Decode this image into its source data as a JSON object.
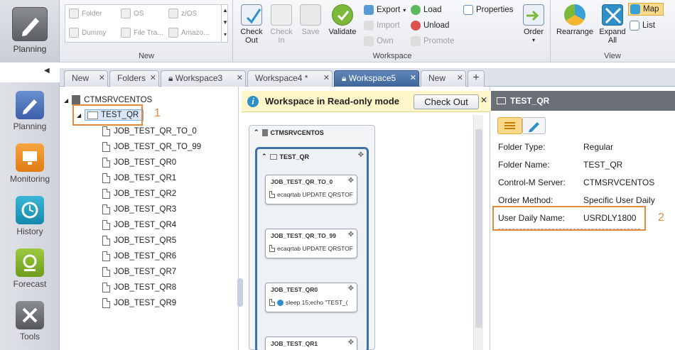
{
  "ribbon": {
    "planning_label": "Planning",
    "new_group": {
      "title": "New",
      "items": [
        "Folder",
        "OS",
        "z/OS",
        "Dummy",
        "File Tra...",
        "Amazo..."
      ]
    },
    "workspace_group": {
      "title": "Workspace",
      "check_out": "Check Out",
      "check_in": "Check In",
      "save": "Save",
      "validate": "Validate",
      "export": "Export",
      "import": "Import",
      "own": "Own",
      "load": "Load",
      "unload": "Unload",
      "promote": "Promote",
      "properties": "Properties",
      "order": "Order"
    },
    "view_group": {
      "title": "View",
      "rearrange": "Rearrange",
      "expand_all": "Expand All",
      "map": "Map",
      "list": "List"
    }
  },
  "tabs": [
    {
      "label": "New"
    },
    {
      "label": "Folders"
    },
    {
      "label": "Workspace3"
    },
    {
      "label": "Workspace4 *"
    },
    {
      "label": "Workspace5"
    },
    {
      "label": "New"
    }
  ],
  "nav": [
    {
      "label": "Planning"
    },
    {
      "label": "Monitoring"
    },
    {
      "label": "History"
    },
    {
      "label": "Forecast"
    },
    {
      "label": "Tools"
    }
  ],
  "tree": {
    "server": "CTMSRVCENTOS",
    "folder": "TEST_QR",
    "jobs": [
      "JOB_TEST_QR_TO_0",
      "JOB_TEST_QR_TO_99",
      "JOB_TEST_QR0",
      "JOB_TEST_QR1",
      "JOB_TEST_QR2",
      "JOB_TEST_QR3",
      "JOB_TEST_QR4",
      "JOB_TEST_QR5",
      "JOB_TEST_QR6",
      "JOB_TEST_QR7",
      "JOB_TEST_QR8",
      "JOB_TEST_QR9"
    ]
  },
  "map": {
    "banner": "Workspace in Read-only mode",
    "check_out": "Check Out",
    "server": "CTMSRVCENTOS",
    "folder": "TEST_QR",
    "cards": [
      {
        "title": "JOB_TEST_QR_TO_0",
        "body": "ecaqrtab UPDATE QRSTOF"
      },
      {
        "title": "JOB_TEST_QR_TO_99",
        "body": "ecaqrtab UPDATE QRSTOF"
      },
      {
        "title": "JOB_TEST_QR0",
        "body": "sleep 15;echo \"TEST_("
      },
      {
        "title": "JOB_TEST_QR1",
        "body": ""
      }
    ]
  },
  "props": {
    "title": "TEST_QR",
    "rows": [
      {
        "key": "Folder Type:",
        "value": "Regular"
      },
      {
        "key": "Folder Name:",
        "value": "TEST_QR"
      },
      {
        "key": "Control-M Server:",
        "value": "CTMSRVCENTOS"
      },
      {
        "key": "Order Method:",
        "value": "Specific User Daily"
      },
      {
        "key": "User Daily Name:",
        "value": "USRDLY1800"
      }
    ]
  },
  "callouts": {
    "one": "1",
    "two": "2"
  },
  "colors": {
    "accent_orange": "#e4893a",
    "active_tab": "#4a73a8",
    "banner": "#fff7c9"
  }
}
